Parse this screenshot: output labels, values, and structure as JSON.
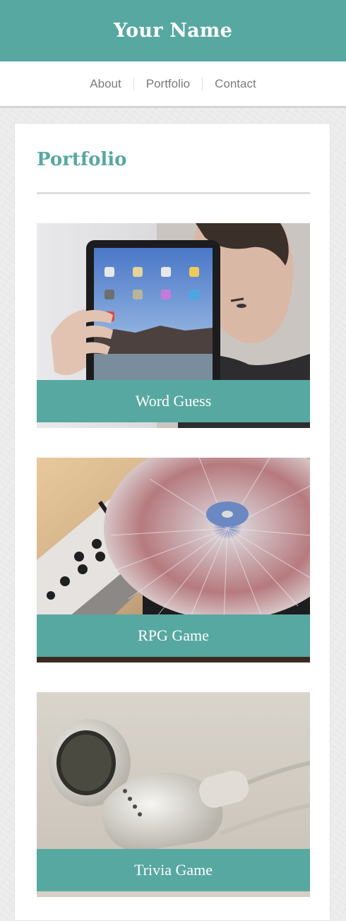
{
  "header": {
    "site_title": "Your Name"
  },
  "nav": {
    "items": [
      {
        "label": "About"
      },
      {
        "label": "Portfolio"
      },
      {
        "label": "Contact"
      }
    ]
  },
  "main": {
    "section_title": "Portfolio",
    "items": [
      {
        "caption": "Word Guess",
        "image": "person-holding-tablet"
      },
      {
        "caption": "RPG Game",
        "image": "dj-turntable-mixer"
      },
      {
        "caption": "Trivia Game",
        "image": "white-earbuds"
      }
    ]
  },
  "colors": {
    "accent": "#57a8a1",
    "nav_text": "#7a7a7a",
    "page_background": "#ebebeb"
  }
}
